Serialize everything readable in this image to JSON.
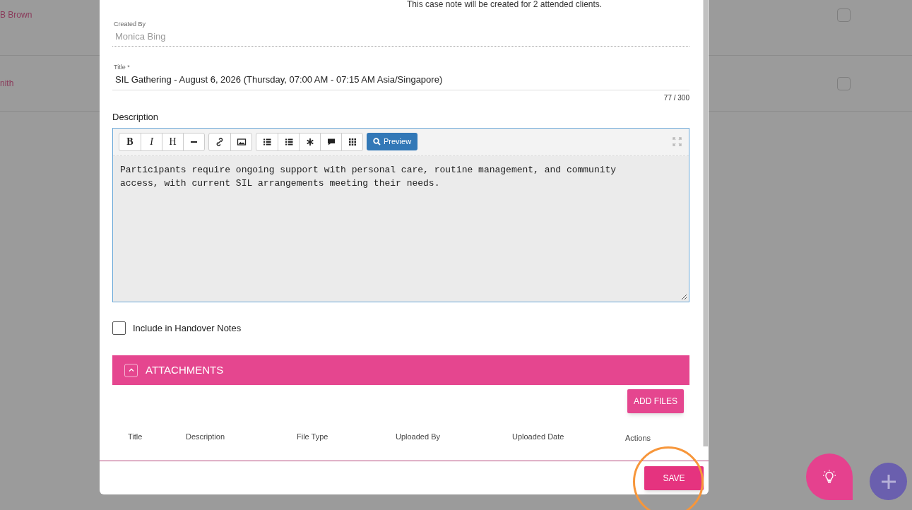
{
  "background_rows": [
    {
      "name": "B Brown",
      "checked": false
    },
    {
      "name": "nith",
      "checked": false
    }
  ],
  "modal": {
    "notice": "This case note will be created for 2 attended clients.",
    "created_by": {
      "label": "Created By",
      "value": "Monica Bing"
    },
    "title_field": {
      "label": "Title *",
      "value": "SIL Gathering - August 6, 2026 (Thursday, 07:00 AM - 07:15 AM Asia/Singapore)",
      "counter": "77 / 300"
    },
    "description": {
      "label": "Description",
      "toolbar": [
        [
          {
            "kind": "bold",
            "label": "B"
          },
          {
            "kind": "italic",
            "label": "I"
          },
          {
            "kind": "heading",
            "label": "H"
          },
          {
            "kind": "rule"
          }
        ],
        [
          {
            "kind": "link"
          },
          {
            "kind": "image"
          }
        ],
        [
          {
            "kind": "bullets"
          },
          {
            "kind": "numbers"
          },
          {
            "kind": "asterisk"
          },
          {
            "kind": "comment"
          },
          {
            "kind": "grid"
          }
        ]
      ],
      "preview": "Preview",
      "text": "Participants require ongoing support with personal care, routine management, and community access, with current SIL arrangements meeting their needs."
    },
    "handover": {
      "label": "Include in Handover Notes",
      "checked": false
    },
    "attachments": {
      "title": "ATTACHMENTS",
      "expanded": true,
      "add_button": "ADD FILES",
      "columns": [
        "Title",
        "Description",
        "File Type",
        "Uploaded By",
        "Uploaded Date",
        "Actions"
      ]
    },
    "save_button": "SAVE"
  }
}
